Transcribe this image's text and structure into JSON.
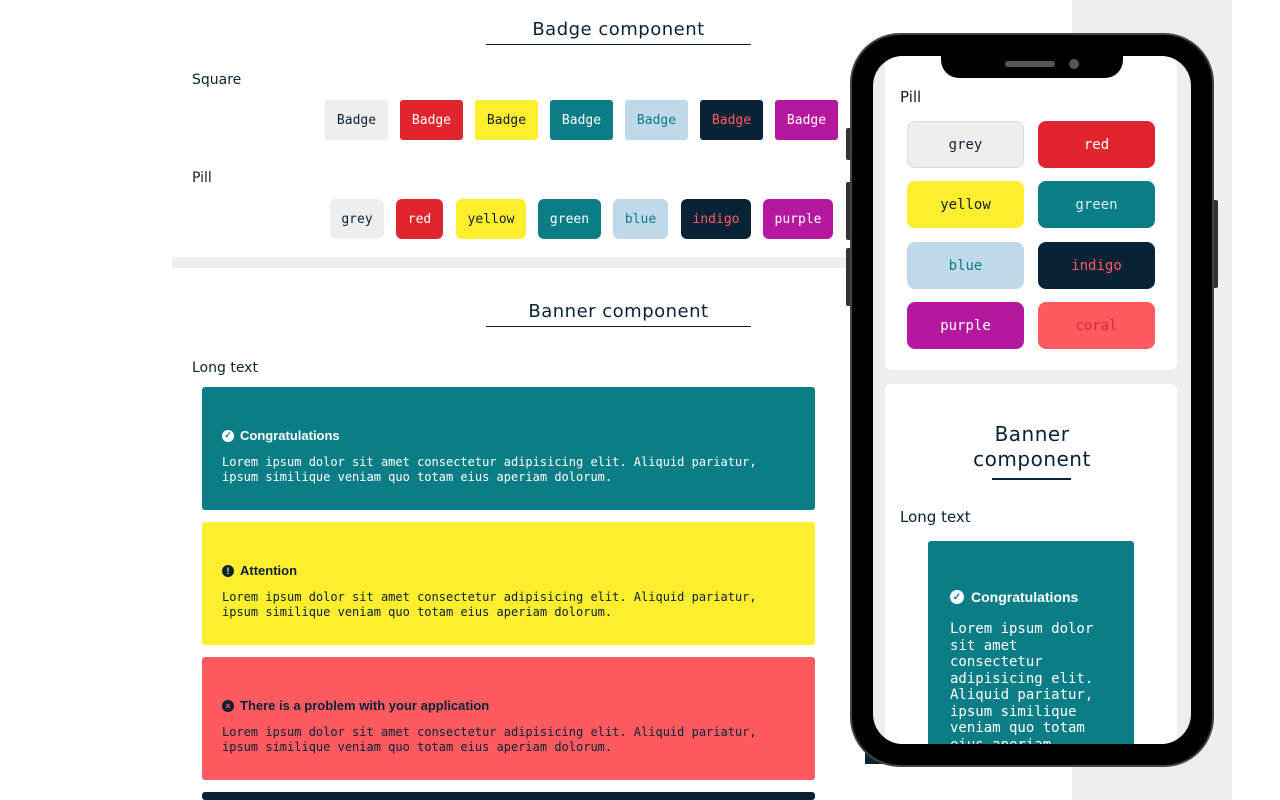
{
  "badge_section": {
    "title": "Badge component",
    "square_label": "Square",
    "pill_label": "Pill",
    "square_badges": [
      {
        "label": "Badge",
        "bg": "#eeeeef",
        "fg": "#0a2236"
      },
      {
        "label": "Badge",
        "bg": "#e1252f",
        "fg": "#ffffff"
      },
      {
        "label": "Badge",
        "bg": "#feee2e",
        "fg": "#0a2236"
      },
      {
        "label": "Badge",
        "bg": "#0a7d87",
        "fg": "#ffffff"
      },
      {
        "label": "Badge",
        "bg": "#bfd8ea",
        "fg": "#0a7d87"
      },
      {
        "label": "Badge",
        "bg": "#0a2236",
        "fg": "#ff5a5f"
      },
      {
        "label": "Badge",
        "bg": "#b5189e",
        "fg": "#ffffff"
      }
    ],
    "pill_badges": [
      {
        "label": "grey",
        "bg": "#eeeeef",
        "fg": "#0a2236"
      },
      {
        "label": "red",
        "bg": "#e1252f",
        "fg": "#ffffff"
      },
      {
        "label": "yellow",
        "bg": "#feee2e",
        "fg": "#0a2236"
      },
      {
        "label": "green",
        "bg": "#0a7d87",
        "fg": "#ffffff"
      },
      {
        "label": "blue",
        "bg": "#bfd8ea",
        "fg": "#0a7d87"
      },
      {
        "label": "indigo",
        "bg": "#0a2236",
        "fg": "#ff5a5f"
      },
      {
        "label": "purple",
        "bg": "#b5189e",
        "fg": "#ffffff"
      }
    ]
  },
  "banner_section": {
    "title": "Banner component",
    "long_text_label": "Long text",
    "banners": [
      {
        "title": "Congratulations",
        "icon": "check-circle-icon",
        "icon_glyph": "✓",
        "body": "Lorem ipsum dolor sit amet consectetur adipisicing elit. Aliquid pariatur, ipsum similique veniam quo totam eius aperiam dolorum.",
        "bg": "#0a7d87",
        "fg": "#ffffff"
      },
      {
        "title": "Attention",
        "icon": "exclamation-circle-icon",
        "icon_glyph": "!",
        "body": "Lorem ipsum dolor sit amet consectetur adipisicing elit. Aliquid pariatur, ipsum similique veniam quo totam eius aperiam dolorum.",
        "bg": "#feee2e",
        "fg": "#0a2236"
      },
      {
        "title": "There is a problem with your application",
        "icon": "x-circle-icon",
        "icon_glyph": "×",
        "body": "Lorem ipsum dolor sit amet consectetur adipisicing elit. Aliquid pariatur, ipsum similique veniam quo totam eius aperiam dolorum.",
        "bg": "#ff5a5f",
        "fg": "#0a2236"
      }
    ]
  },
  "mobile": {
    "pill_label": "Pill",
    "pills": [
      {
        "label": "grey",
        "bg": "#eeeeef",
        "fg": "#0a2236"
      },
      {
        "label": "red",
        "bg": "#e1252f",
        "fg": "#ffffff"
      },
      {
        "label": "yellow",
        "bg": "#feee2e",
        "fg": "#0a2236"
      },
      {
        "label": "green",
        "bg": "#0a7d87",
        "fg": "#d8f0f2"
      },
      {
        "label": "blue",
        "bg": "#bfd8ea",
        "fg": "#0a7d87"
      },
      {
        "label": "indigo",
        "bg": "#0a2236",
        "fg": "#ff5a5f"
      },
      {
        "label": "purple",
        "bg": "#b5189e",
        "fg": "#ffffff"
      },
      {
        "label": "coral",
        "bg": "#ff5a5f",
        "fg": "#e1252f"
      }
    ],
    "banner_title_line1": "Banner",
    "banner_title_line2": "component",
    "long_text_label": "Long text",
    "banner": {
      "title": "Congratulations",
      "icon": "check-circle-icon",
      "icon_glyph": "✓",
      "body": "Lorem ipsum dolor sit amet consectetur adipisicing elit. Aliquid pariatur, ipsum similique veniam quo totam eius aperiam"
    }
  }
}
